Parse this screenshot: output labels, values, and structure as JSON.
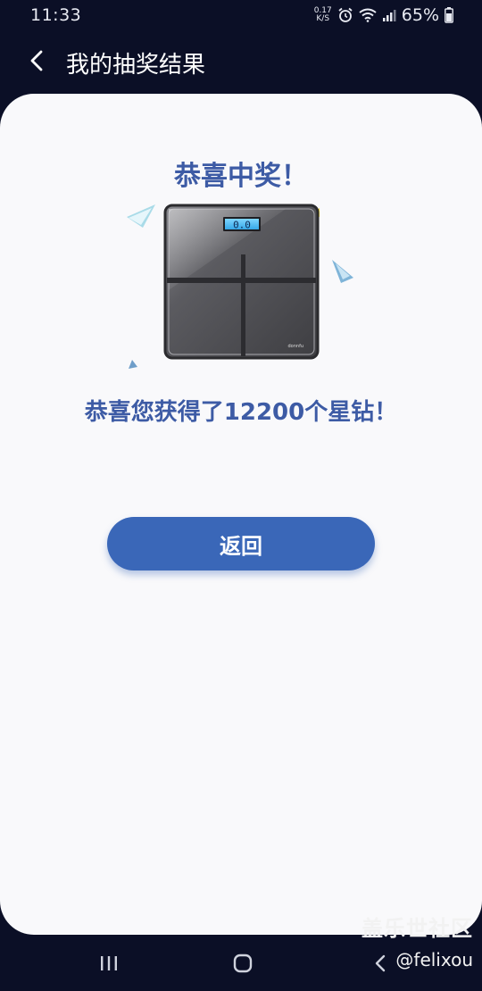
{
  "status_bar": {
    "time": "11:33",
    "net_speed_value": "0.17",
    "net_speed_unit": "K/S",
    "battery": "65%"
  },
  "header": {
    "title": "我的抽奖结果",
    "back_icon": "chevron-left-icon"
  },
  "result": {
    "title": "恭喜中奖！",
    "prize_image": "bathroom-scale",
    "scale_display": "0.0",
    "scale_brand": "donnfu",
    "message": "恭喜您获得了12200个星钻！"
  },
  "actions": {
    "return_label": "返回"
  },
  "watermark": {
    "brand": "盖乐世社区",
    "handle": "@felixou"
  },
  "colors": {
    "page_background": "#0b0f26",
    "card_background": "#f9f9fb",
    "title_blue": "#3d5ba5",
    "button_blue": "#3a67b8"
  }
}
